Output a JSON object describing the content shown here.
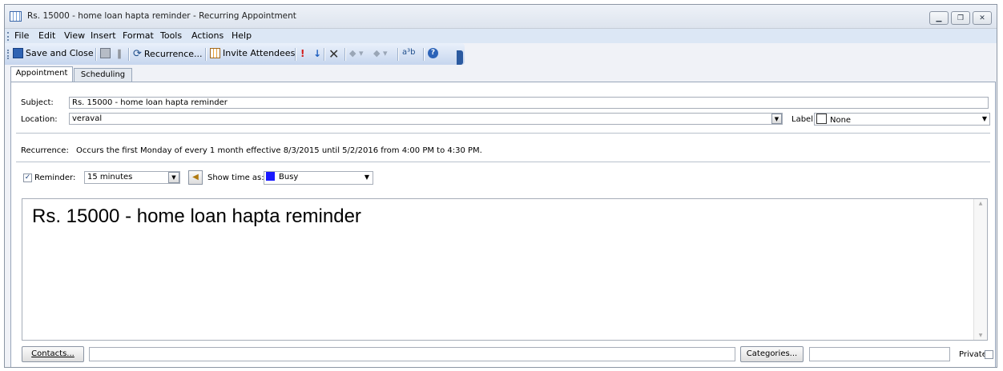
{
  "window": {
    "title": "Rs. 15000 - home loan hapta reminder - Recurring Appointment",
    "controls": [
      "minimize",
      "restore",
      "close"
    ]
  },
  "menu": {
    "items": [
      "File",
      "Edit",
      "View",
      "Insert",
      "Format",
      "Tools",
      "Actions",
      "Help"
    ]
  },
  "toolbar": {
    "save_close": "Save and Close",
    "recurrence": "Recurrence...",
    "invite": "Invite Attendees"
  },
  "tabs": [
    "Appointment",
    "Scheduling"
  ],
  "form": {
    "subject_label": "Subject:",
    "subject_value": "Rs. 15000 - home loan hapta reminder",
    "location_label": "Location:",
    "location_value": "veraval",
    "label_label": "Label:",
    "label_value": "None",
    "recurrence_label": "Recurrence:",
    "recurrence_text": "Occurs the first Monday of every 1 month effective 8/3/2015 until 5/2/2016 from 4:00 PM to 4:30 PM.",
    "reminder_label": "Reminder:",
    "reminder_checked": true,
    "reminder_value": "15 minutes",
    "show_time_label": "Show time as:",
    "show_time_value": "Busy",
    "busy_color": "#1a1aff"
  },
  "body": {
    "text": "Rs. 15000 - home loan hapta reminder"
  },
  "footer": {
    "contacts_button": "Contacts...",
    "contacts_value": "",
    "categories_button": "Categories...",
    "categories_value": "",
    "private_label": "Private",
    "private_checked": false
  }
}
